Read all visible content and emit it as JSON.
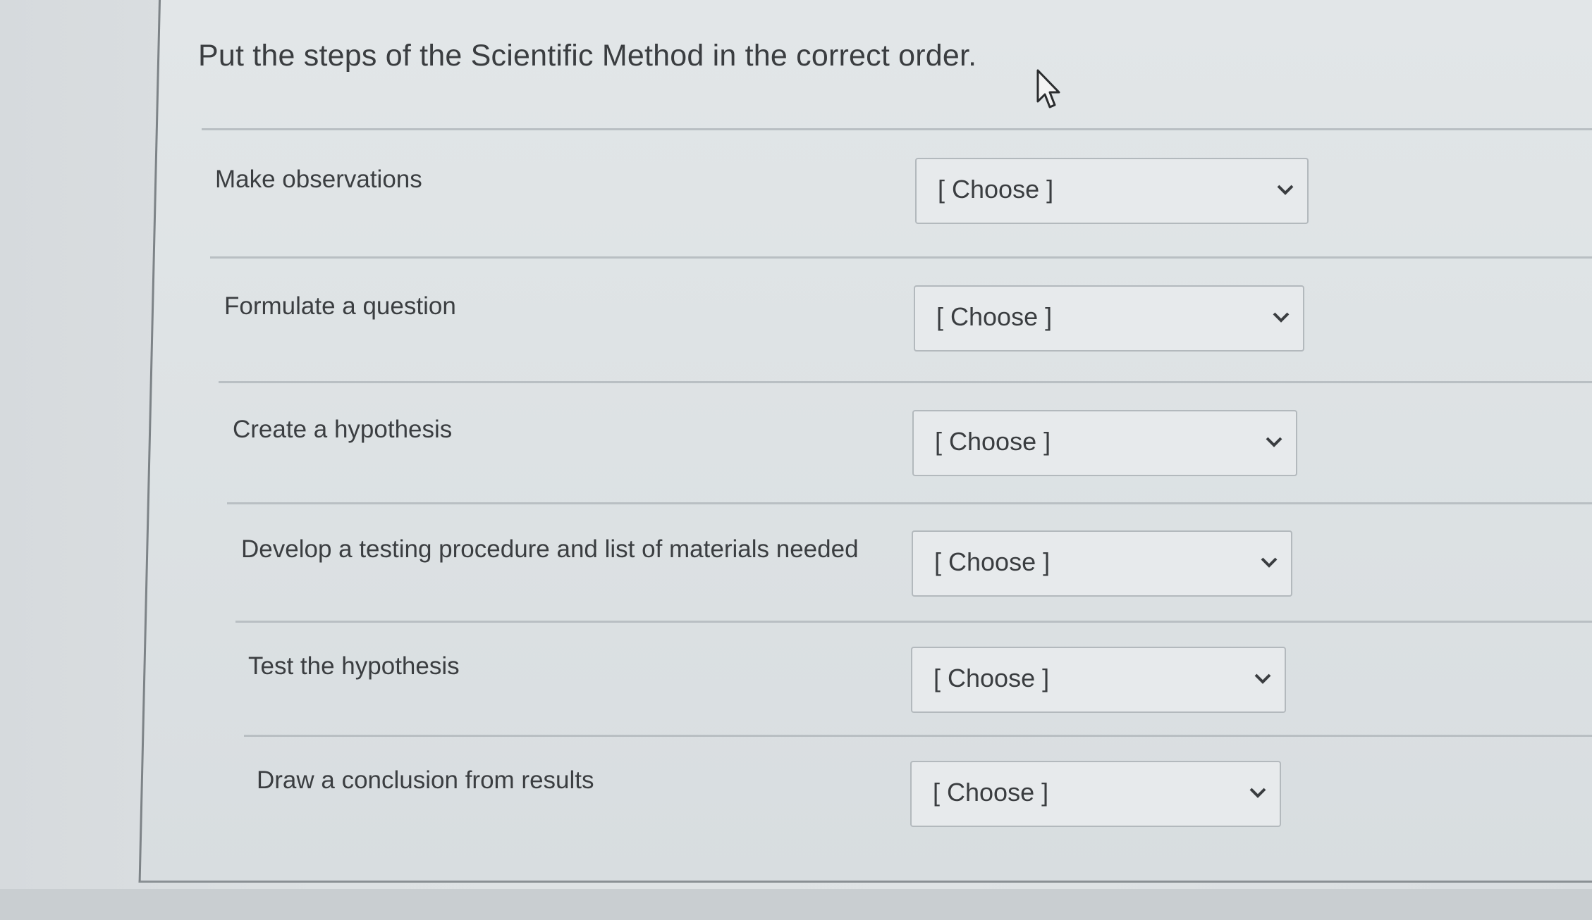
{
  "question": {
    "title": "Put the steps of the Scientific Method in the correct order."
  },
  "rows": [
    {
      "label": "Make observations",
      "select_value": "[ Choose ]"
    },
    {
      "label": "Formulate a question",
      "select_value": "[ Choose ]"
    },
    {
      "label": "Create a hypothesis",
      "select_value": "[ Choose ]"
    },
    {
      "label": "Develop a testing procedure and list of materials needed",
      "select_value": "[ Choose ]"
    },
    {
      "label": "Test the hypothesis",
      "select_value": "[ Choose ]"
    },
    {
      "label": "Draw a conclusion from results",
      "select_value": "[ Choose ]"
    }
  ],
  "icons": {
    "cursor": "mouse-pointer-icon",
    "dropdown": "chevron-down-icon"
  },
  "colors": {
    "text": "#3a3d40",
    "select_bg": "#e7eaec",
    "select_border": "#b3b9bd"
  }
}
